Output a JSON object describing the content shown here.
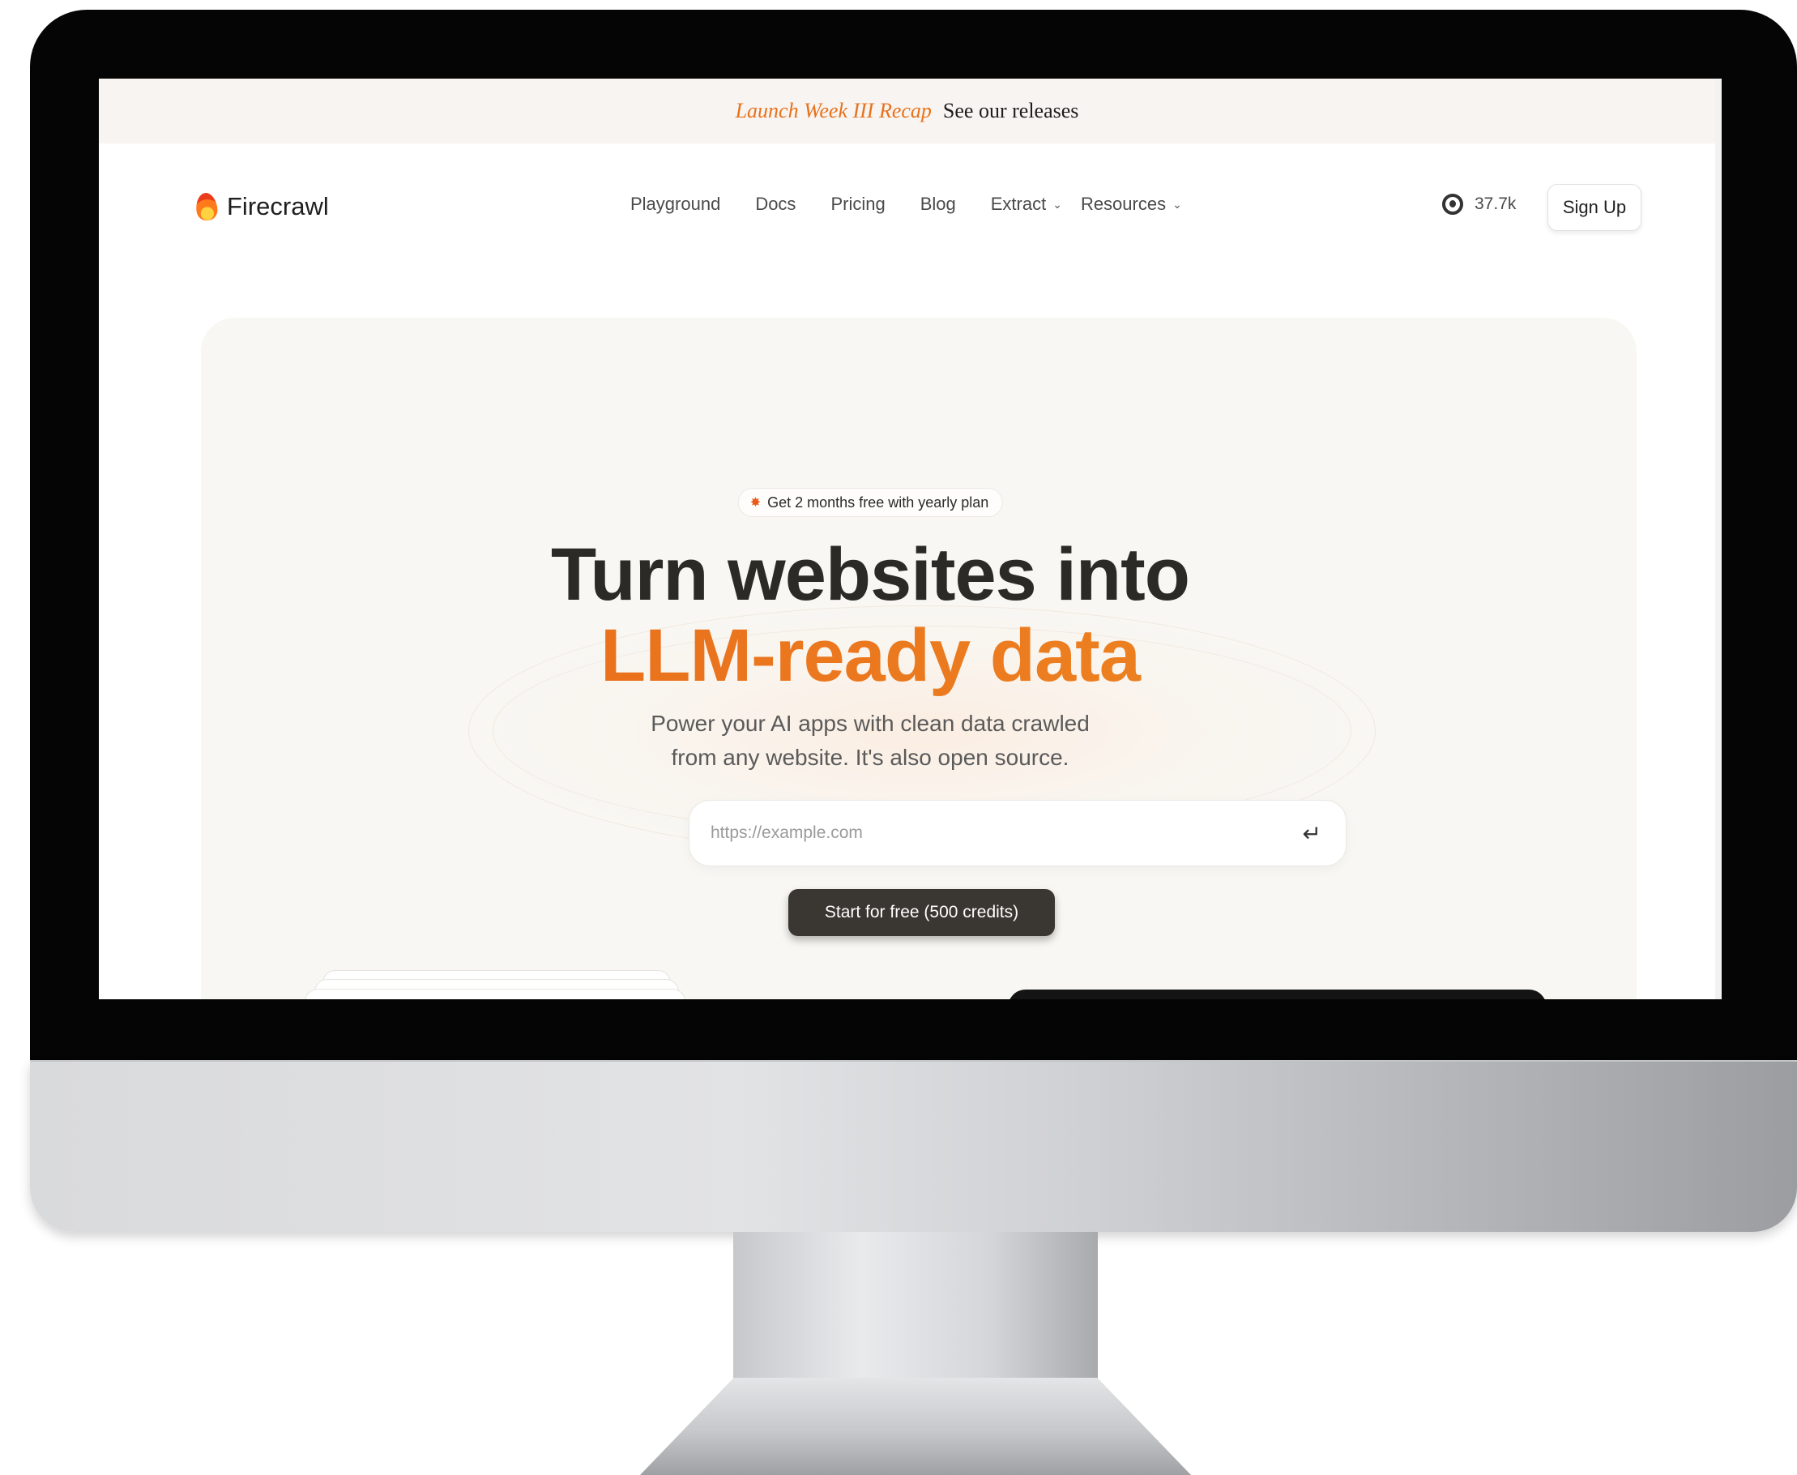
{
  "announcement": {
    "highlight": "Launch Week III Recap",
    "link": "See our releases"
  },
  "nav": {
    "brand": "Firecrawl",
    "items": [
      {
        "label": "Playground"
      },
      {
        "label": "Docs"
      },
      {
        "label": "Pricing"
      },
      {
        "label": "Blog"
      },
      {
        "label": "Extract"
      },
      {
        "label": "Resources"
      }
    ],
    "github_stars": "37.7k",
    "signup_label": "Sign Up"
  },
  "hero": {
    "promo": "Get 2 months free with yearly plan",
    "title_line1": "Turn websites into",
    "title_line2": "LLM-ready data",
    "subtitle_line1": "Power your AI apps with clean data crawled",
    "subtitle_line2": "from any website. It's also open source.",
    "url_placeholder": "https://example.com",
    "cta_label": "Start for free (500 credits)"
  },
  "colors": {
    "accent": "#e9781f",
    "hero_bg": "#f8f7f3",
    "cta_bg": "#3a3631"
  }
}
